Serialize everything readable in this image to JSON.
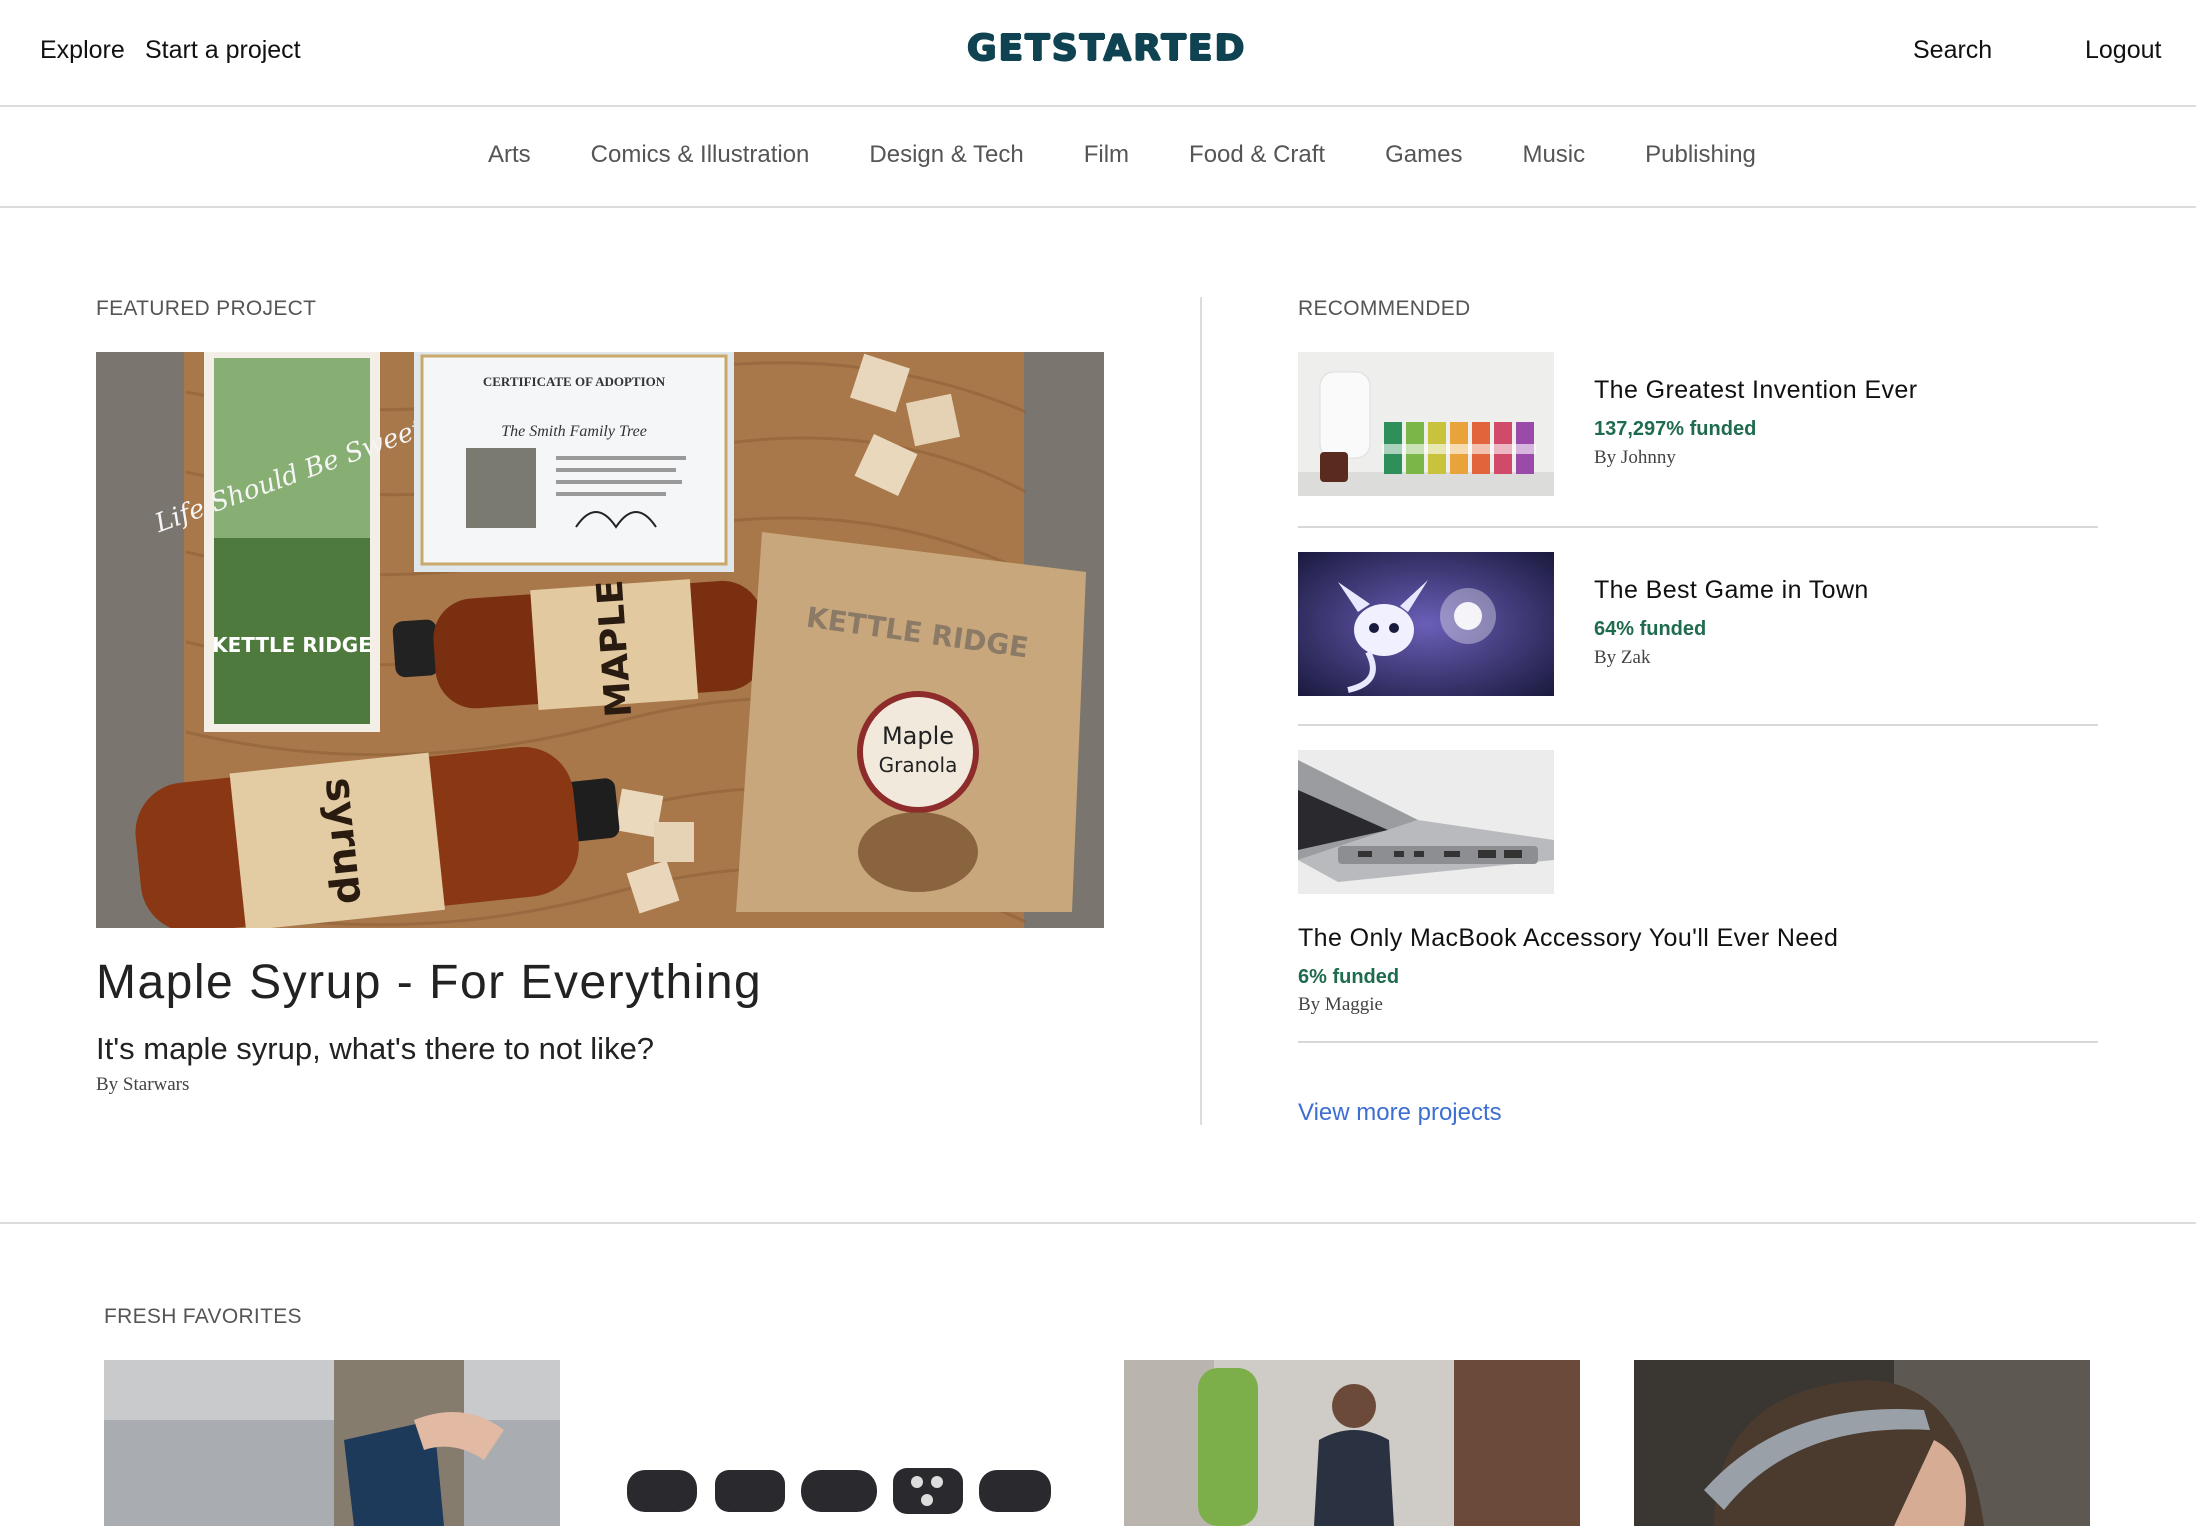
{
  "header": {
    "explore_label": "Explore",
    "start_label": "Start a project",
    "logo_text": "GETSTARTED",
    "search_label": "Search",
    "logout_label": "Logout"
  },
  "categories": [
    "Arts",
    "Comics & Illustration",
    "Design & Tech",
    "Film",
    "Food & Craft",
    "Games",
    "Music",
    "Publishing"
  ],
  "featured": {
    "section_label": "FEATURED PROJECT",
    "title": "Maple Syrup - For Everything",
    "description": "It's maple syrup, what's there to not like?",
    "author": "By Starwars",
    "image_text": {
      "certificate_title": "CERTIFICATE OF ADOPTION",
      "certificate_family": "The Smith Family Tree",
      "card_script": "Life Should Be Sweet",
      "card_brand": "KETTLE RIDGE",
      "bag_brand": "KETTLE RIDGE",
      "bag_label_line1": "Maple",
      "bag_label_line2": "Granola",
      "bottle_label_line1": "MAPLE",
      "bottle_label_line2": "syrup"
    }
  },
  "recommended": {
    "section_label": "RECOMMENDED",
    "items": [
      {
        "title": "The Greatest Invention Ever",
        "funded": "137,297% funded",
        "author": "By Johnny"
      },
      {
        "title": "The Best Game in Town",
        "funded": "64% funded",
        "author": "By Zak"
      },
      {
        "title": "The Only MacBook Accessory You'll Ever Need",
        "funded": "6% funded",
        "author": "By Maggie"
      }
    ],
    "view_more_label": "View more projects"
  },
  "fresh_favorites": {
    "section_label": "FRESH FAVORITES"
  },
  "colors": {
    "logo": "#0f4351",
    "funded": "#1f6b4e",
    "link": "#3d6fd1",
    "divider": "#dcdcdc"
  }
}
